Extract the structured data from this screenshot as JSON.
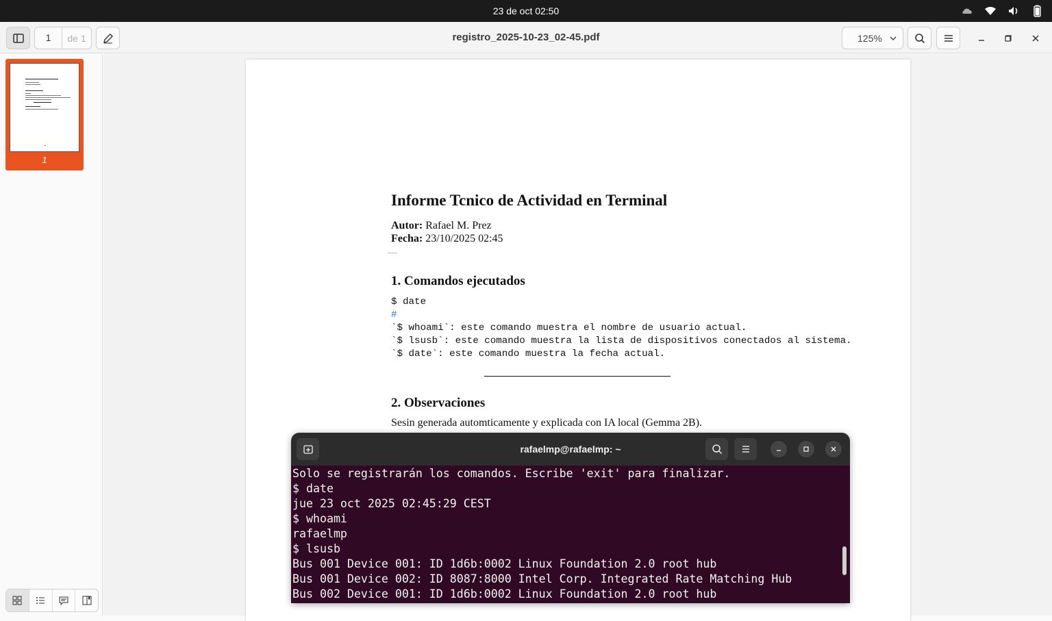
{
  "topbar": {
    "clock": "23 de oct  02:50"
  },
  "header": {
    "page_current": "1",
    "page_total": "de 1",
    "title": "registro_2025-10-23_02-45.pdf",
    "zoom": "125%"
  },
  "sidebar": {
    "thumb_label": "1"
  },
  "pdf": {
    "title": "Informe Tcnico de Actividad en Terminal",
    "author_label": "Autor:",
    "author": "Rafael M. Prez",
    "date_label": "Fecha:",
    "date": "23/10/2025 02:45",
    "section1": "1. Comandos ejecutados",
    "code": [
      "$ date",
      "#",
      "`$ whoami`: este comando muestra el nombre de usuario actual.",
      "`$ lsusb`: este comando muestra la lista de dispositivos conectados al sistema.",
      "`$ date`: este comando muestra la fecha actual."
    ],
    "section2": "2. Observaciones",
    "paragraph": "Sesin generada automticamente y explicada con IA local (Gemma 2B)."
  },
  "terminal": {
    "title": "rafaelmp@rafaelmp: ~",
    "lines": [
      "Solo se registrarán los comandos. Escribe 'exit' para finalizar.",
      "$ date",
      "jue 23 oct 2025 02:45:29 CEST",
      "$ whoami",
      "rafaelmp",
      "$ lsusb",
      "Bus 001 Device 001: ID 1d6b:0002 Linux Foundation 2.0 root hub",
      "Bus 001 Device 002: ID 8087:8000 Intel Corp. Integrated Rate Matching Hub",
      "Bus 002 Device 001: ID 1d6b:0002 Linux Foundation 2.0 root hub"
    ]
  },
  "colors": {
    "accent": "#e95420",
    "terminal_bg": "#300a24"
  }
}
